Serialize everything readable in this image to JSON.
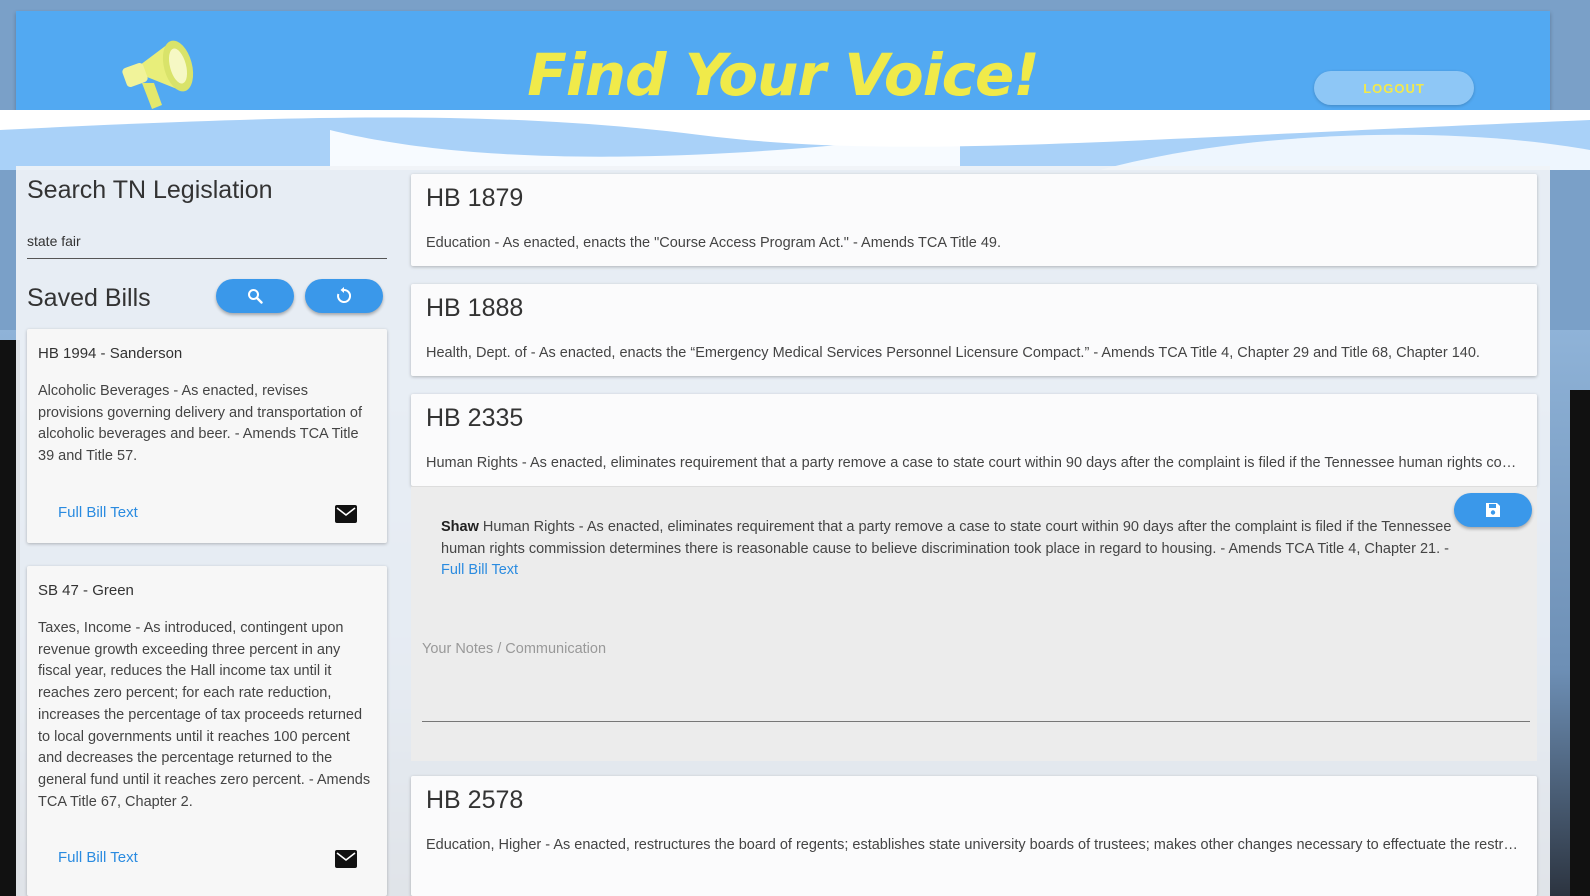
{
  "header": {
    "title": "Find Your Voice!",
    "logout_label": "LOGOUT",
    "megaphone_icon": "megaphone-icon"
  },
  "sidebar": {
    "search_title": "Search TN Legislation",
    "search_value": "state fair",
    "saved_title": "Saved Bills",
    "search_button_icon": "search-icon",
    "reset_button_icon": "refresh-icon",
    "saved_bills": [
      {
        "title": "HB 1994 - Sanderson",
        "description": "Alcoholic Beverages - As enacted, revises provisions governing delivery and transportation of alcoholic beverages and beer. - Amends TCA Title 39 and Title 57.",
        "link": "Full Bill Text"
      },
      {
        "title": "SB 47 - Green",
        "description": "Taxes, Income - As introduced, contingent upon revenue growth exceeding three percent in any fiscal year, reduces the Hall income tax until it reaches zero percent; for each rate reduction, increases the percentage of tax proceeds returned to local governments until it reaches 100 percent and decreases the percentage returned to the general fund until it reaches zero percent. - Amends TCA Title 67, Chapter 2.",
        "link": "Full Bill Text"
      }
    ]
  },
  "bills": [
    {
      "number": "HB 1879",
      "description": "Education - As enacted, enacts the \"Course Access Program Act.\" - Amends TCA Title 49."
    },
    {
      "number": "HB 1888",
      "description": "Health, Dept. of - As enacted, enacts the “Emergency Medical Services Personnel Licensure Compact.” - Amends TCA Title 4, Chapter 29 and Title 68, Chapter 140."
    },
    {
      "number": "HB 2335",
      "description": "Human Rights - As enacted, eliminates requirement that a party remove a case to state court within 90 days after the complaint is filed if the Tennessee human rights commission determines there is reasonable cause to believe discrimination took place in regard to housing. - Amends TCA Title 4, Chapter 21."
    },
    {
      "number": "HB 2578",
      "description": "Education, Higher - As enacted, restructures the board of regents; establishes state university boards of trustees; makes other changes necessary to effectuate the restructuring."
    }
  ],
  "expanded": {
    "sponsor": "Shaw",
    "text": "Human Rights - As enacted, eliminates requirement that a party remove a case to state court within 90 days after the complaint is filed if the Tennessee human rights commission determines there is reasonable cause to believe discrimination took place in regard to housing. - Amends TCA Title 4, Chapter 21. -",
    "link": "Full Bill Text",
    "notes_label": "Your Notes / Communication",
    "save_icon": "save-icon"
  },
  "colors": {
    "header_blue": "#52a9f2",
    "title_yellow": "#f0ea4a",
    "button_blue": "#3a98ea",
    "link_blue": "#2a8be0"
  }
}
